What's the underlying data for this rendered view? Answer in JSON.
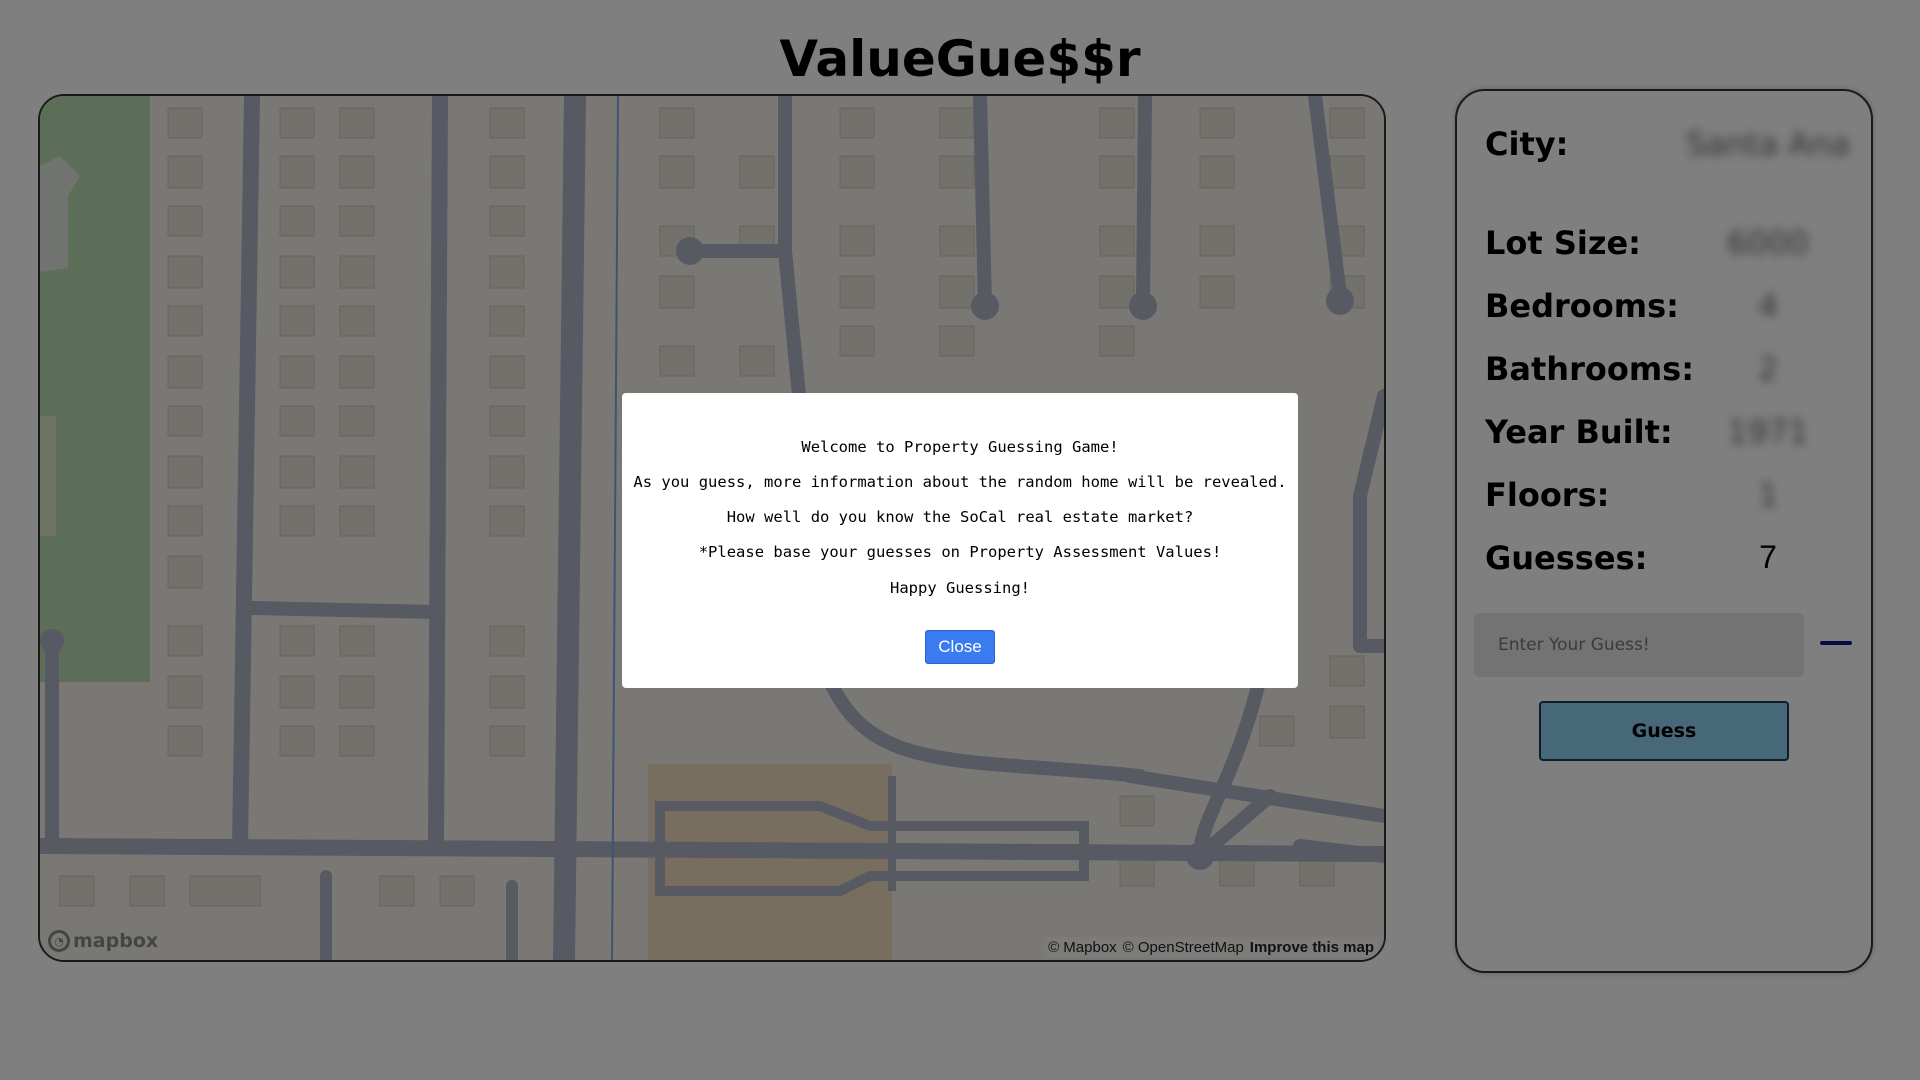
{
  "app": {
    "title": "ValueGue$$r"
  },
  "map": {
    "logo_text": "mapbox",
    "attribution": {
      "mapbox": "© Mapbox",
      "osm": "© OpenStreetMap",
      "improve": "Improve this map"
    }
  },
  "panel": {
    "city": {
      "label": "City:",
      "value": "Santa Ana"
    },
    "lot_size": {
      "label": "Lot Size:",
      "value": "6000"
    },
    "bedrooms": {
      "label": "Bedrooms:",
      "value": "4"
    },
    "bathrooms": {
      "label": "Bathrooms:",
      "value": "2"
    },
    "year_built": {
      "label": "Year Built:",
      "value": "1971"
    },
    "floors": {
      "label": "Floors:",
      "value": "1"
    },
    "guesses": {
      "label": "Guesses:",
      "value": "7"
    },
    "guess_input_placeholder": "Enter Your Guess!",
    "guess_button_label": "Guess"
  },
  "modal": {
    "line1": "Welcome to Property Guessing Game!",
    "line2": "As you guess, more information about the random home will be revealed.",
    "line3": "How well do you know the SoCal real estate market?",
    "line4": "*Please base your guesses on Property Assessment Values!",
    "line5": "Happy Guessing!",
    "close_label": "Close"
  },
  "colors": {
    "overlay": "#000000",
    "close_button": "#3b7bf0",
    "guess_button": "#8fd0f2",
    "dash": "#0b1a8c"
  }
}
